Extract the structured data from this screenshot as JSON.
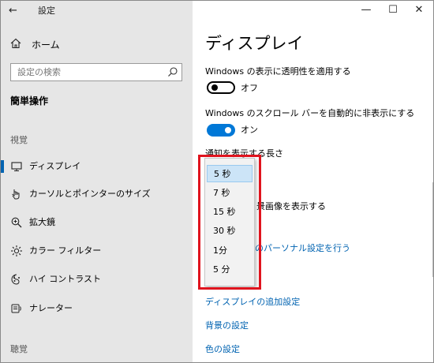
{
  "titlebar": {
    "back_icon": "back-arrow-icon",
    "title": "設定",
    "minimize": "—",
    "maximize": "☐",
    "close": "✕"
  },
  "sidebar": {
    "home": {
      "icon": "home-icon",
      "label": "ホーム"
    },
    "search": {
      "placeholder": "設定の検索",
      "icon": "search-icon"
    },
    "section_heading": "簡単操作",
    "groups": [
      {
        "label": "視覚"
      },
      {
        "label": "聴覚"
      }
    ],
    "items": [
      {
        "icon": "monitor-icon",
        "label": "ディスプレイ",
        "active": true
      },
      {
        "icon": "cursor-pointer-icon",
        "label": "カーソルとポインターのサイズ",
        "active": false
      },
      {
        "icon": "magnifier-icon",
        "label": "拡大鏡",
        "active": false
      },
      {
        "icon": "color-filter-icon",
        "label": "カラー フィルター",
        "active": false
      },
      {
        "icon": "high-contrast-icon",
        "label": "ハイ コントラスト",
        "active": false
      },
      {
        "icon": "narrator-icon",
        "label": "ナレーター",
        "active": false
      }
    ]
  },
  "main": {
    "title": "ディスプレイ",
    "transparency": {
      "label": "Windows の表示に透明性を適用する",
      "state": "オフ",
      "on": false
    },
    "scrollbars": {
      "label": "Windows のスクロール バーを自動的に非表示にする",
      "state": "オン",
      "on": true
    },
    "notification_duration": {
      "label": "通知を表示する長さ"
    },
    "background_partial": "景画像を表示する",
    "personalize_partial": "のパーソナル設定を行う",
    "links": {
      "additional_display": "ディスプレイの追加設定",
      "background": "背景の設定",
      "color": "色の設定"
    }
  },
  "dropdown": {
    "selected": "5 秒",
    "options": [
      "5 秒",
      "7 秒",
      "15 秒",
      "30 秒",
      "1分",
      "5 分"
    ]
  },
  "colors": {
    "accent": "#0078d7",
    "link": "#0063b1",
    "highlight": "#e0141e",
    "sidebar_bg": "#e6e6e6"
  }
}
